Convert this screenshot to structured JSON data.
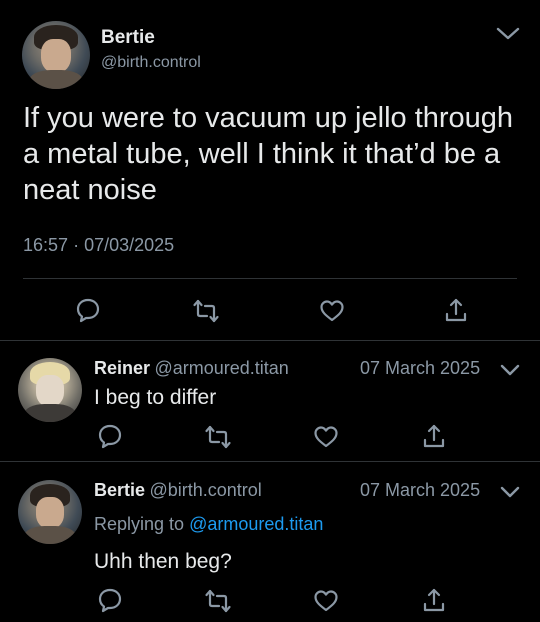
{
  "main_tweet": {
    "author_name": "Bertie",
    "author_handle": "@birth.control",
    "text": "If you were to vacuum up jello through a metal tube, well I think it that’d be a neat noise",
    "time": "16:57",
    "separator": "·",
    "date": "07/03/2025"
  },
  "replies": [
    {
      "author_name": "Reiner",
      "author_handle": "@armoured.titan",
      "date": "07 March 2025",
      "text": "I beg to differ"
    },
    {
      "author_name": "Bertie",
      "author_handle": "@birth.control",
      "date": "07 March 2025",
      "replying_prefix": "Replying to",
      "replying_to": "@armoured.titan",
      "text": "Uhh then beg?"
    }
  ],
  "icons": {
    "reply": "reply-icon",
    "retweet": "retweet-icon",
    "like": "heart-icon",
    "share": "share-icon",
    "more": "chevron-down-icon"
  },
  "colors": {
    "background": "#000000",
    "text": "#e7e9ea",
    "muted": "#8b98a5",
    "link": "#1d9bf0",
    "divider": "#2f3336"
  }
}
